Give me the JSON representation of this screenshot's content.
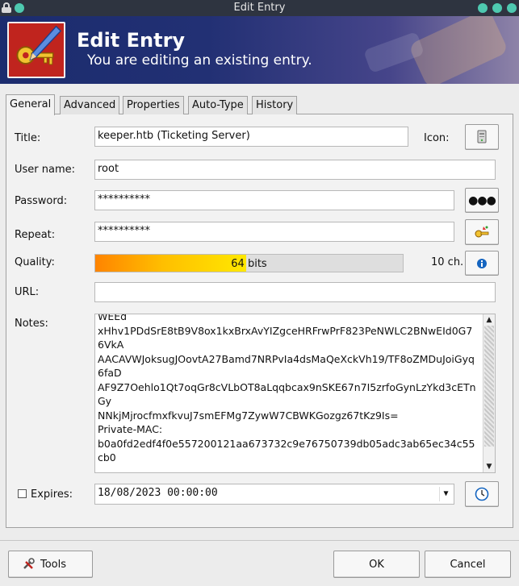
{
  "window": {
    "title": "Edit Entry"
  },
  "header": {
    "title": "Edit Entry",
    "subtitle": "You are editing an existing entry."
  },
  "tabs": [
    {
      "label": "General",
      "active": true
    },
    {
      "label": "Advanced",
      "active": false
    },
    {
      "label": "Properties",
      "active": false
    },
    {
      "label": "Auto-Type",
      "active": false
    },
    {
      "label": "History",
      "active": false
    }
  ],
  "form": {
    "title_label": "Title:",
    "title_value": "keeper.htb (Ticketing Server)",
    "icon_label": "Icon:",
    "username_label": "User name:",
    "username_value": "root",
    "password_label": "Password:",
    "password_value": "**********",
    "repeat_label": "Repeat:",
    "repeat_value": "**********",
    "quality_label": "Quality:",
    "quality_text": "64 bits",
    "quality_fraction": 0.49,
    "char_count": "10 ch.",
    "url_label": "URL:",
    "url_value": "",
    "notes_label": "Notes:",
    "notes_value": "WEEd\nxHhv1PDdSrE8tB9V8ox1kxBrxAvYIZgceHRFrwPrF823PeNWLC2BNwEId0G7\n6VkA\nAACAVWJoksugJOovtA27Bamd7NRPvIa4dsMaQeXckVh19/TF8oZMDuJoiGyq\n6faD\nAF9Z7Oehlo1Qt7oqGr8cVLbOT8aLqqbcax9nSKE67n7I5zrfoGynLzYkd3cETn\nGy\nNNkjMjrocfmxfkvuJ7smEFMg7ZywW7CBWKGozgz67tKz9Is=\nPrivate-MAC:\nb0a0fd2edf4f0e557200121aa673732c9e76750739db05adc3ab65ec34c55\ncb0",
    "expires_label": "Expires:",
    "expires_value": "18/08/2023 00:00:00",
    "expires_checked": false
  },
  "buttons": {
    "tools": "Tools",
    "ok": "OK",
    "cancel": "Cancel"
  },
  "colors": {
    "banner": "#1b2c6e",
    "quality_start": "#ff8400",
    "quality_end": "#ffe800",
    "info": "#1565c0"
  }
}
